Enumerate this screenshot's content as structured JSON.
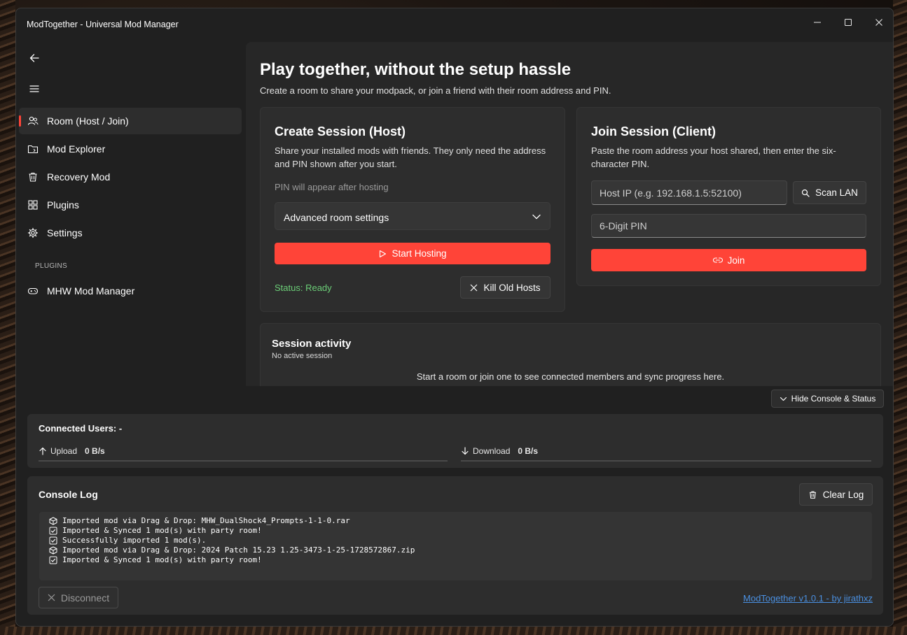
{
  "window": {
    "title": "ModTogether - Universal Mod Manager"
  },
  "sidebar": {
    "items": [
      {
        "label": "Room (Host / Join)",
        "icon": "people-icon",
        "active": true
      },
      {
        "label": "Mod Explorer",
        "icon": "folder-icon"
      },
      {
        "label": "Recovery Mod",
        "icon": "trash-icon"
      },
      {
        "label": "Plugins",
        "icon": "puzzle-icon"
      },
      {
        "label": "Settings",
        "icon": "gear-icon"
      }
    ],
    "section_label": "PLUGINS",
    "plugins": [
      {
        "label": "MHW Mod Manager",
        "icon": "gamepad-icon"
      }
    ]
  },
  "main": {
    "title": "Play together, without the setup hassle",
    "subtitle": "Create a room to share your modpack, or join a friend with their room address and PIN.",
    "host": {
      "title": "Create Session (Host)",
      "description": "Share your installed mods with friends. They only need the address and PIN shown after you start.",
      "pin_hint": "PIN will appear after hosting",
      "advanced_label": "Advanced room settings",
      "start_label": "Start Hosting",
      "status": "Status: Ready",
      "kill_label": "Kill Old Hosts"
    },
    "join": {
      "title": "Join Session (Client)",
      "description": "Paste the room address your host shared, then enter the six-character PIN.",
      "ip_placeholder": "Host IP (e.g. 192.168.1.5:52100)",
      "scan_label": "Scan LAN",
      "pin_placeholder": "6-Digit PIN",
      "join_label": "Join"
    },
    "activity": {
      "title": "Session activity",
      "subtitle": "No active session",
      "empty_text": "Start a room or join one to see connected members and sync progress here."
    }
  },
  "console_toggle_label": "Hide Console & Status",
  "stats": {
    "connected_users": "Connected Users: -",
    "upload_label": "Upload",
    "upload_value": "0 B/s",
    "download_label": "Download",
    "download_value": "0 B/s"
  },
  "console": {
    "title": "Console Log",
    "clear_label": "Clear Log",
    "lines": [
      {
        "icon": "package-icon",
        "text": "Imported mod via Drag & Drop: MHW_DualShock4_Prompts-1-1-0.rar"
      },
      {
        "icon": "check-box-icon",
        "text": "Imported & Synced 1 mod(s) with party room!"
      },
      {
        "icon": "check-box-icon",
        "text": "Successfully imported 1 mod(s)."
      },
      {
        "icon": "package-icon",
        "text": "Imported mod via Drag & Drop: 2024 Patch 15.23 1.25-3473-1-25-1728572867.zip"
      },
      {
        "icon": "check-box-icon",
        "text": "Imported & Synced 1 mod(s) with party room!"
      }
    ],
    "disconnect_label": "Disconnect",
    "footer_link": "ModTogether v1.0.1 - by jirathxz"
  },
  "colors": {
    "accent": "#ff4438",
    "status_ready": "#6ccf78",
    "link": "#4a8fe0"
  }
}
